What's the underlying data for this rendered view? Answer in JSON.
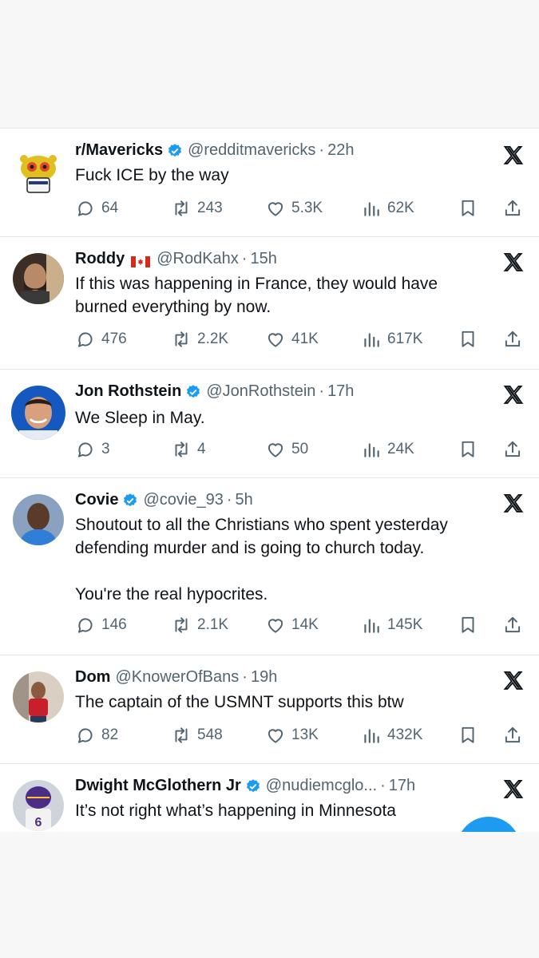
{
  "tweets": [
    {
      "name": "r/Mavericks",
      "verified": true,
      "flag": false,
      "handle": "@redditmavericks",
      "time": "22h",
      "text": "Fuck ICE by the way",
      "avatar": "reddit-mavericks-snoo",
      "replies": "64",
      "reposts": "243",
      "likes": "5.3K",
      "views": "62K"
    },
    {
      "name": "Roddy",
      "verified": false,
      "flag": true,
      "handle": "@RodKahx",
      "time": "15h",
      "text": "If this was happening in France, they would have\nburned everything by now.",
      "avatar": "bearded-man-door",
      "replies": "476",
      "reposts": "2.2K",
      "likes": "41K",
      "views": "617K"
    },
    {
      "name": "Jon Rothstein",
      "verified": true,
      "flag": false,
      "handle": "@JonRothstein",
      "time": "17h",
      "text": "We Sleep in May.",
      "avatar": "smiling-man-blue",
      "replies": "3",
      "reposts": "4",
      "likes": "50",
      "views": "24K"
    },
    {
      "name": "Covie",
      "verified": true,
      "flag": false,
      "handle": "@covie_93",
      "time": "5h",
      "text": "Shoutout to all the Christians who spent yesterday\ndefending murder and is going to church today.\n\nYou're the real hypocrites.",
      "avatar": "man-blue-hoodie",
      "replies": "146",
      "reposts": "2.1K",
      "likes": "14K",
      "views": "145K"
    },
    {
      "name": "Dom",
      "verified": false,
      "flag": false,
      "handle": "@KnowerOfBans",
      "time": "19h",
      "text": "The captain of the USMNT supports this btw",
      "avatar": "child-red-shirt",
      "replies": "82",
      "reposts": "548",
      "likes": "13K",
      "views": "432K"
    },
    {
      "name": "Dwight McGlothern Jr",
      "verified": true,
      "flag": false,
      "handle": "@nudiemcglo...",
      "time": "17h",
      "text": "It’s not right what’s happening in Minnesota",
      "avatar": "football-player-6",
      "replies": "",
      "reposts": "",
      "likes": "",
      "views": ""
    }
  ],
  "icons": {
    "reply": "reply-icon",
    "repost": "repost-icon",
    "like": "like-icon",
    "views": "views-icon",
    "bookmark": "bookmark-icon",
    "share": "share-icon",
    "platform": "x-logo-icon"
  },
  "colors": {
    "verified": "#1d9bf0",
    "text": "#0f1419",
    "secondary": "#536471",
    "fab": "#1d9bf0"
  }
}
